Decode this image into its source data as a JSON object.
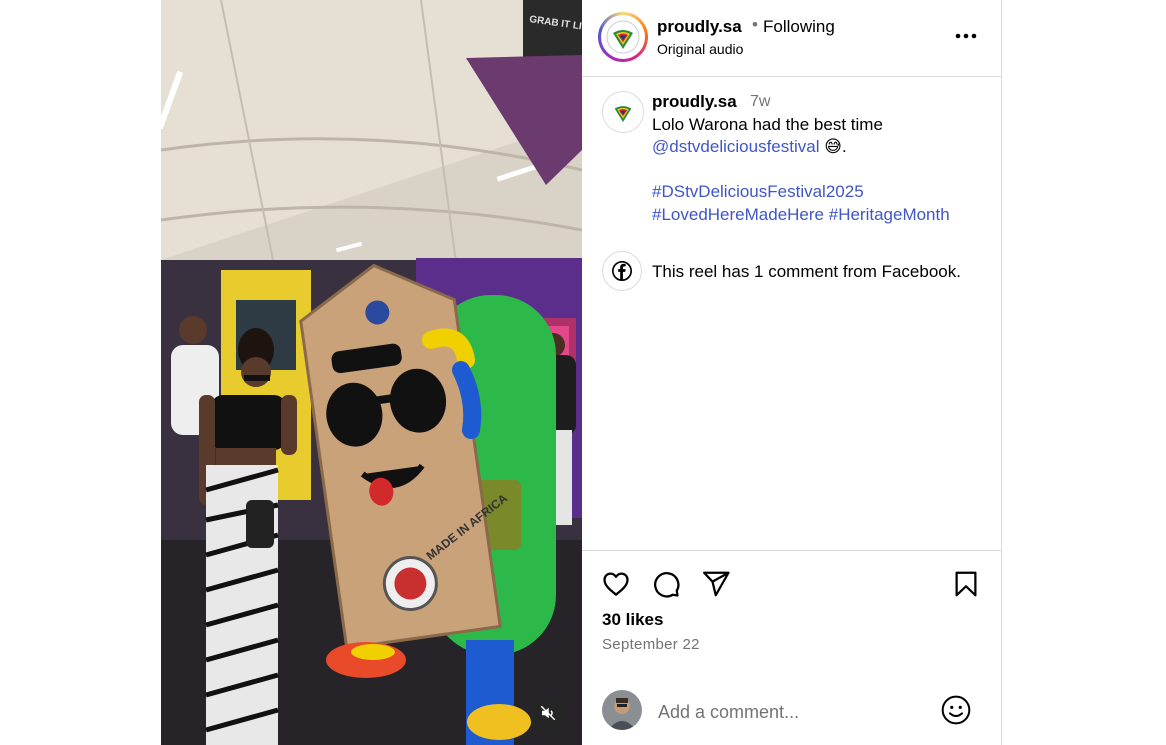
{
  "post": {
    "username": "proudly.sa",
    "separator": "•",
    "follow_state": "Following",
    "audio": "Original audio",
    "caption_user": "proudly.sa",
    "caption_time": "7w",
    "caption_line1": "Lolo Warona had the best time",
    "caption_mention": "@dstvdeliciousfestival",
    "caption_mention_suffix": " 😅.",
    "hashtag1": "#DStvDeliciousFestival2025",
    "hashtag2": "#LovedHereMadeHere",
    "hashtag3": "#HeritageMonth",
    "facebook_note": "This reel has 1 comment from Facebook.",
    "likes": "30 likes",
    "date": "September 22"
  },
  "comment": {
    "placeholder": "Add a comment..."
  },
  "media": {
    "sign_text": "GRAB IT LIKE IT'S LOCAL.",
    "badge_text": "MADE IN AFRICA"
  },
  "colors": {
    "link": "#3f56c8",
    "border": "#dbdbdb",
    "muted": "#737373"
  },
  "icons": [
    "more-options-icon",
    "facebook-icon",
    "heart-icon",
    "comment-icon",
    "share-icon",
    "bookmark-icon",
    "emoji-icon",
    "muted-speaker-icon"
  ]
}
